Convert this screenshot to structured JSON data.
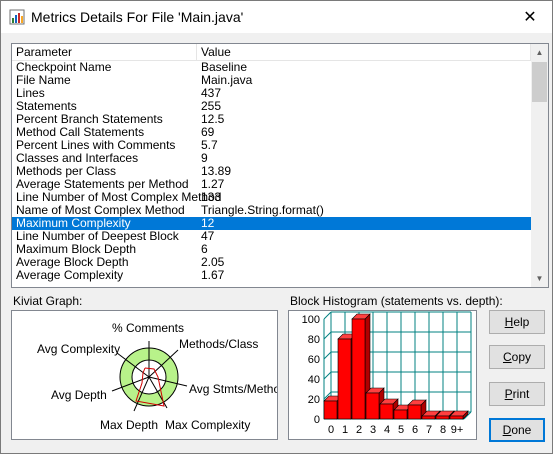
{
  "window": {
    "title": "Metrics Details For File 'Main.java'",
    "close_glyph": "✕"
  },
  "table": {
    "headers": [
      "Parameter",
      "Value"
    ],
    "rows": [
      {
        "p": "Checkpoint Name",
        "v": "Baseline"
      },
      {
        "p": "File Name",
        "v": "Main.java"
      },
      {
        "p": "Lines",
        "v": "437"
      },
      {
        "p": "Statements",
        "v": "255"
      },
      {
        "p": "Percent Branch Statements",
        "v": "12.5"
      },
      {
        "p": "Method Call Statements",
        "v": "69"
      },
      {
        "p": "Percent Lines with Comments",
        "v": "5.7"
      },
      {
        "p": "Classes and Interfaces",
        "v": "9"
      },
      {
        "p": "Methods per Class",
        "v": "13.89"
      },
      {
        "p": "Average Statements per Method",
        "v": "1.27"
      },
      {
        "p": "Line Number of Most Complex Method",
        "v": "133"
      },
      {
        "p": "Name of Most Complex Method",
        "v": "Triangle.String.format()"
      },
      {
        "p": "Maximum Complexity",
        "v": "12",
        "selected": true
      },
      {
        "p": "Line Number of Deepest Block",
        "v": "47"
      },
      {
        "p": "Maximum Block Depth",
        "v": "6"
      },
      {
        "p": "Average Block Depth",
        "v": "2.05"
      },
      {
        "p": "Average Complexity",
        "v": "1.67"
      }
    ]
  },
  "kiviat": {
    "label": "Kiviat Graph:",
    "axes": [
      "% Comments",
      "Methods/Class",
      "Avg Stmts/Method",
      "Max Complexity",
      "Max Depth",
      "Avg Depth",
      "Avg Complexity"
    ]
  },
  "histogram": {
    "label": "Block Histogram (statements vs. depth):",
    "y_ticks": [
      "100",
      "80",
      "60",
      "40",
      "20",
      "0"
    ],
    "x_ticks": [
      "0",
      "1",
      "2",
      "3",
      "4",
      "5",
      "6",
      "7",
      "8",
      "9+"
    ],
    "bar_color": "#ff0000",
    "grid_color": "#008080"
  },
  "chart_data": {
    "type": "bar",
    "title": "Block Histogram (statements vs. depth):",
    "categories": [
      "0",
      "1",
      "2",
      "3",
      "4",
      "5",
      "6",
      "7",
      "8",
      "9+"
    ],
    "values": [
      18,
      80,
      100,
      26,
      15,
      9,
      14,
      3,
      3,
      3
    ],
    "ylim": [
      0,
      100
    ],
    "grid": true
  },
  "buttons": {
    "help": {
      "pre": "",
      "u": "H",
      "post": "elp"
    },
    "copy": {
      "pre": "",
      "u": "C",
      "post": "opy"
    },
    "print": {
      "pre": "",
      "u": "P",
      "post": "rint"
    },
    "done": {
      "pre": "",
      "u": "D",
      "post": "one"
    }
  }
}
